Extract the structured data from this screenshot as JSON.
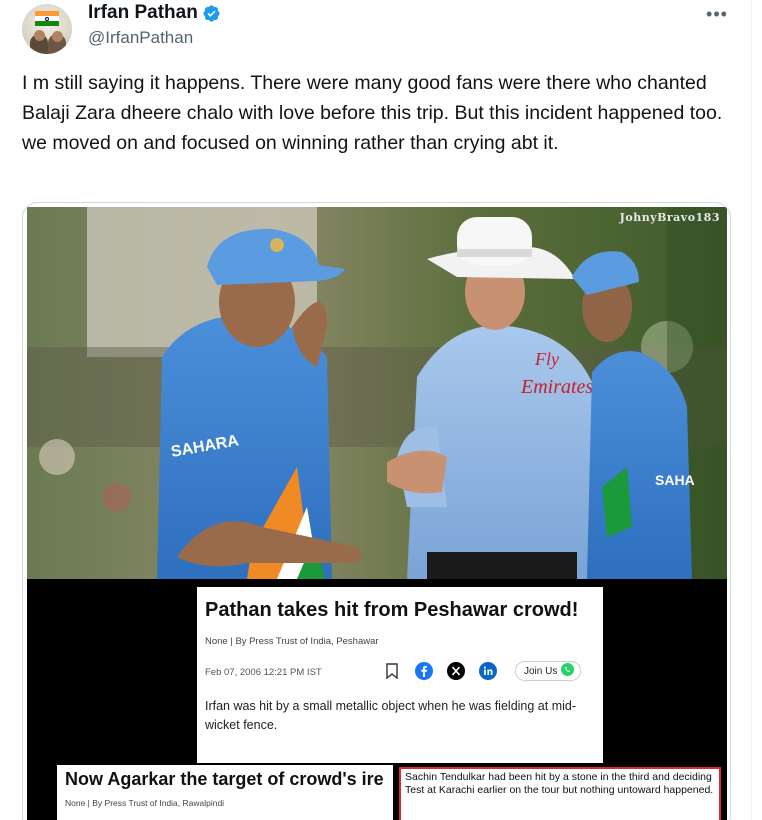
{
  "author": {
    "display_name": "Irfan Pathan",
    "handle": "@IrfanPathan",
    "verified": true
  },
  "tweet": {
    "text": "I m still saying it happens. There were many good fans were there who chanted Balaji Zara dheere chalo with love before this trip. But this incident happened too. we moved on and focused on winning rather than crying abt it."
  },
  "photo": {
    "watermark": "JohnyBravo183",
    "jersey_text_left": "SAHARA",
    "jersey_text_right": "SAHA",
    "umpire_shirt_text": [
      "Fly",
      "Emirates"
    ]
  },
  "clipping1": {
    "headline": "Pathan takes hit from Peshawar crowd!",
    "byline": "None | By Press Trust of India, Peshawar",
    "dateline": "Feb 07, 2006 12:21 PM IST",
    "join_label": "Join Us",
    "summary": "Irfan was hit by a small metallic object when he was fielding at mid-wicket fence."
  },
  "clipping2": {
    "headline": "Now Agarkar the target of crowd's ire",
    "byline": "None | By Press Trust of India, Rawalpindi"
  },
  "clipping3": {
    "text": "Sachin Tendulkar had been hit by a stone in the third and deciding Test at Karachi earlier on the tour but nothing untoward happened."
  },
  "colors": {
    "verified_blue": "#1d9bf0",
    "handle_gray": "#536471",
    "highlight_red": "#e32636"
  }
}
